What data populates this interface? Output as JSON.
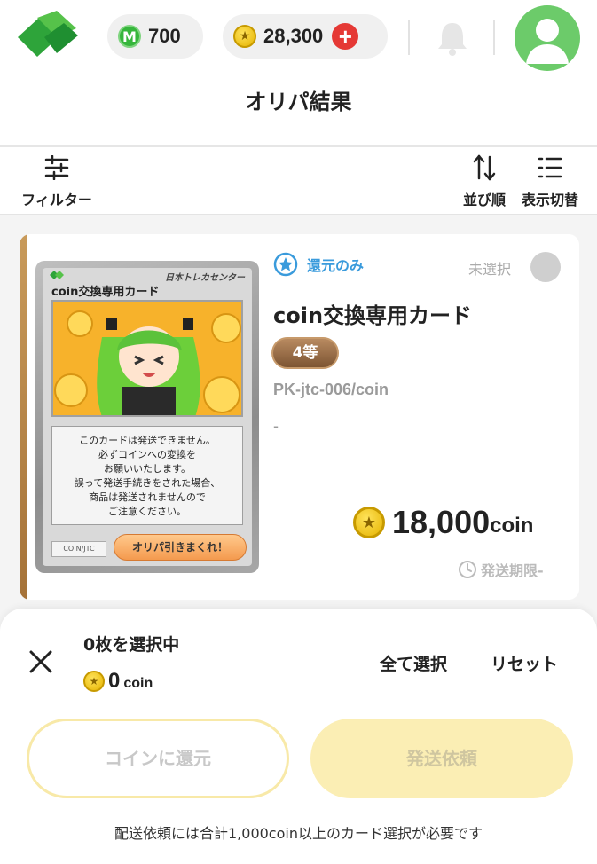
{
  "header": {
    "m_points": "700",
    "m_badge": "M",
    "coins": "28,300",
    "plus_label": "+",
    "icons": [
      "logo-icon",
      "bell-icon",
      "user-avatar-icon"
    ]
  },
  "page": {
    "title": "オリパ結果"
  },
  "toolbar": {
    "filter_label": "フィルター",
    "sort_label": "並び順",
    "view_label": "表示切替"
  },
  "card": {
    "return_tag": "還元のみ",
    "status": "未選択",
    "name": "coin交換専用カード",
    "rank": "4等",
    "code": "PK-jtc-006/coin",
    "dash": "-",
    "price_value": "18,000",
    "price_unit": "coin",
    "deadline": "発送期限-",
    "image": {
      "brand": "日本トレカセンター",
      "name": "coin交換専用カード",
      "text_lines": [
        "このカードは発送できません。",
        "必ずコインへの変換を",
        "お願いいたします。",
        "誤って発送手続きをされた場合、",
        "商品は発送されませんので",
        "ご注意ください。"
      ],
      "code": "COIN/JTC",
      "button": "オリパ引きまくれ！"
    }
  },
  "sheet": {
    "selected_count": "0枚を選択中",
    "selected_coin_value": "0",
    "selected_coin_unit": "coin",
    "select_all": "全て選択",
    "reset": "リセット",
    "return_button": "コインに還元",
    "ship_button": "発送依頼",
    "note": "配送依頼には合計1,000coin以上のカード選択が必要です"
  },
  "colors": {
    "accent_green": "#36b63c",
    "coin_gold": "#e5b300",
    "plus_red": "#e53935",
    "return_blue": "#3a9bdc",
    "rank_brown": "#8d6240",
    "button_disabled_yellow": "#fbeeb4"
  }
}
